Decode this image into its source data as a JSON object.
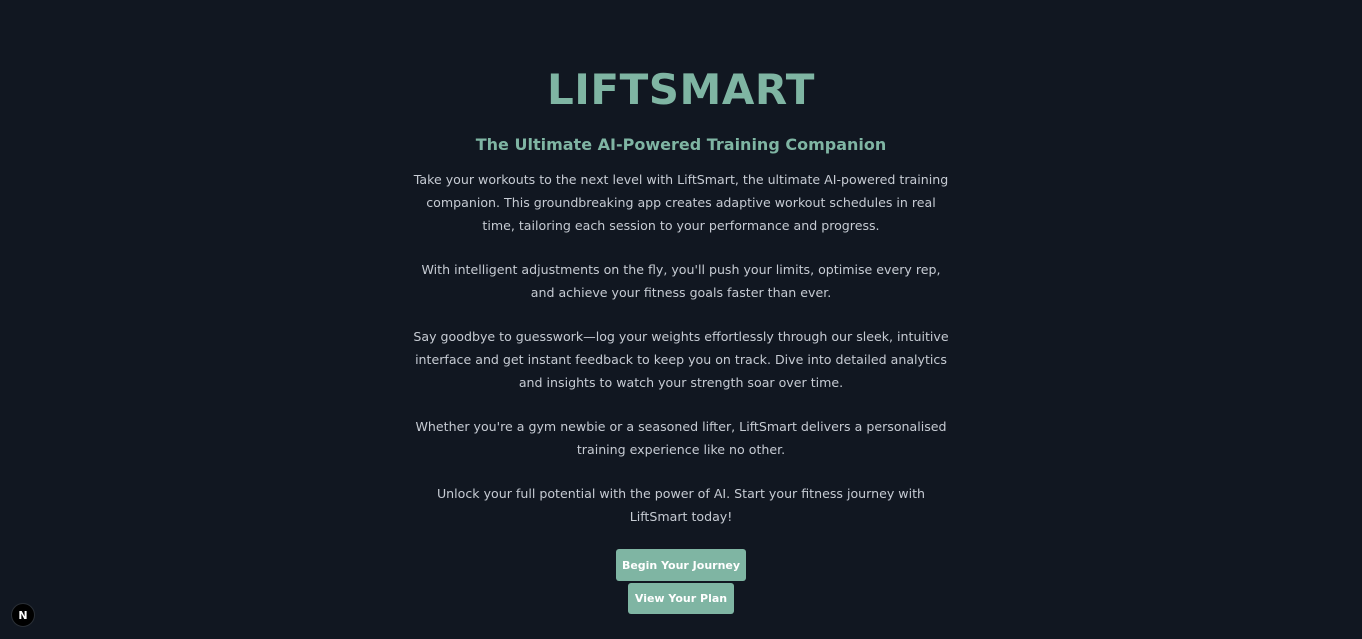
{
  "hero": {
    "title": "LIFTSMART",
    "subtitle": "The Ultimate AI-Powered Training Companion",
    "paragraphs": [
      "Take your workouts to the next level with LiftSmart, the ultimate AI-powered training companion. This groundbreaking app creates adaptive workout schedules in real time, tailoring each session to your performance and progress.",
      "With intelligent adjustments on the fly, you'll push your limits, optimise every rep, and achieve your fitness goals faster than ever.",
      "Say goodbye to guesswork—log your weights effortlessly through our sleek, intuitive interface and get instant feedback to keep you on track. Dive into detailed analytics and insights to watch your strength soar over time.",
      "Whether you're a gym newbie or a seasoned lifter, LiftSmart delivers a personalised training experience like no other.",
      "Unlock your full potential with the power of AI. Start your fitness journey with LiftSmart today!"
    ]
  },
  "actions": {
    "primary_label": "Begin Your Journey",
    "secondary_label": "View Your Plan"
  },
  "dev_badge": {
    "label": "N",
    "icon": "nextjs-logo-icon"
  },
  "colors": {
    "background": "#111721",
    "accent": "#7fb5a3",
    "body_text": "#c6cbd3"
  }
}
